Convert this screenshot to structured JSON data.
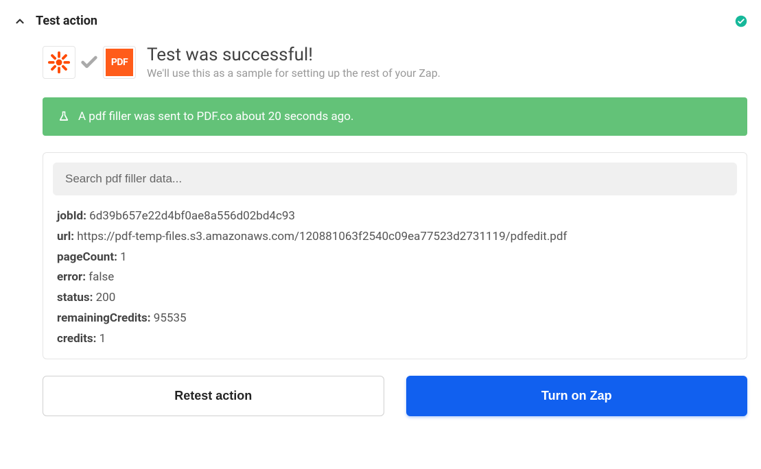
{
  "header": {
    "title": "Test action"
  },
  "success": {
    "heading": "Test was successful!",
    "subtext": "We'll use this as a sample for setting up the rest of your Zap."
  },
  "banner": {
    "message": "A pdf filler was sent to PDF.co about 20 seconds ago."
  },
  "search": {
    "placeholder": "Search pdf filler data..."
  },
  "result": {
    "jobId_label": "jobId:",
    "jobId_value": "6d39b657e22d4bf0ae8a556d02bd4c93",
    "url_label": "url:",
    "url_value": "https://pdf-temp-files.s3.amazonaws.com/120881063f2540c09ea77523d2731119/pdfedit.pdf",
    "pageCount_label": "pageCount:",
    "pageCount_value": "1",
    "error_label": "error:",
    "error_value": "false",
    "status_label": "status:",
    "status_value": "200",
    "remainingCredits_label": "remainingCredits:",
    "remainingCredits_value": "95535",
    "credits_label": "credits:",
    "credits_value": "1"
  },
  "buttons": {
    "retest": "Retest action",
    "turn_on": "Turn on Zap"
  },
  "apps": {
    "pdfco_label": "PDF"
  }
}
